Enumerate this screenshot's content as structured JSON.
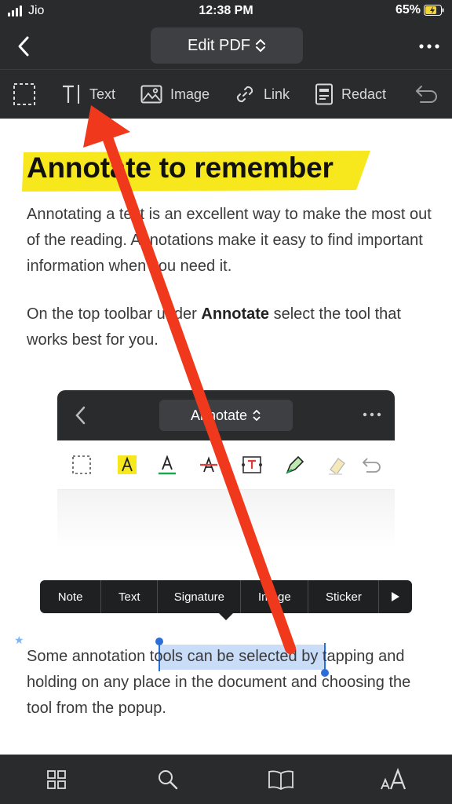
{
  "status": {
    "carrier": "Jio",
    "time": "12:38 PM",
    "battery": "65%"
  },
  "nav": {
    "title": "Edit PDF"
  },
  "toolbar": {
    "text_label": "Text",
    "image_label": "Image",
    "link_label": "Link",
    "redact_label": "Redact"
  },
  "doc": {
    "title": "Annotate to remember",
    "para1": "Annotating a text is an excellent way to make the most out of the reading. Annotations make it easy to find important information when you need it.",
    "para2_before": "On the top toolbar under ",
    "para2_bold": "Annotate",
    "para2_after": " select the tool that works best for you.",
    "embed_title": "Annotate",
    "para3_before": "Some annotation ",
    "para3_selected": "tools can be selected",
    "para3_after": " by tapping and holding on any place in the document and choosing the tool from the popup."
  },
  "popup": {
    "items": [
      "Note",
      "Text",
      "Signature",
      "Image",
      "Sticker"
    ]
  },
  "colors": {
    "highlight": "#f7e81e",
    "arrow": "#f0381c",
    "selection": "#c9dcf8",
    "chrome": "#2a2b2d"
  }
}
